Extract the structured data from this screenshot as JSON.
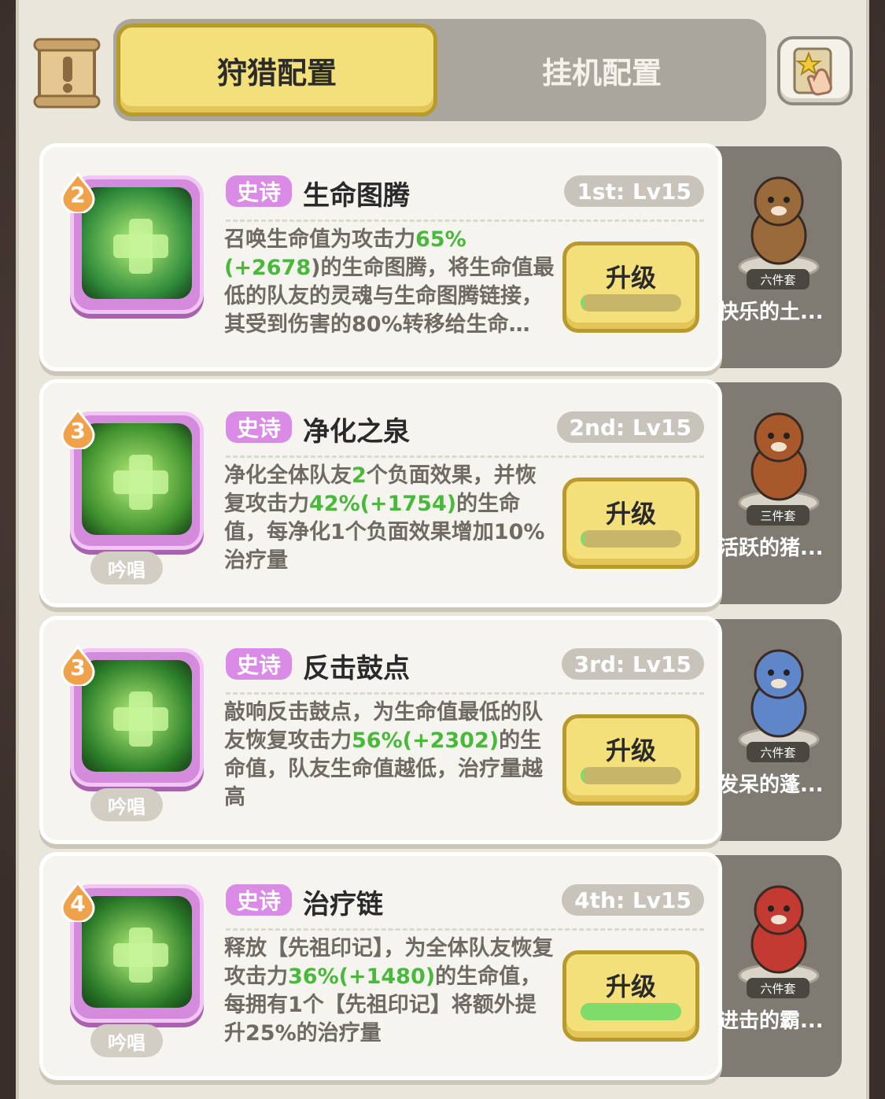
{
  "header": {
    "tab_active": "狩猎配置",
    "tab_inactive": "挂机配置"
  },
  "skills": [
    {
      "rank": "2",
      "rarity": "史诗",
      "name": "生命图腾",
      "level": "1st: Lv15",
      "desc_html": "召唤生命值为攻击力<span class='g'>65%(+2678</span>)的生命图腾，将生命值最低的队友的灵魂与生命图腾链接，其受到伤害的80%转移给生命…",
      "upgrade_label": "升级",
      "progress": 0.03,
      "chant": "",
      "pet_set": "六件套",
      "pet_name": "快乐的土...",
      "icon_color": "#2f8a3a"
    },
    {
      "rank": "3",
      "rarity": "史诗",
      "name": "净化之泉",
      "level": "2nd: Lv15",
      "desc_html": "净化全体队友<span class='g'>2</span>个负面效果，并恢复攻击力<span class='g'>42%(+1754)</span>的生命值，每净化1个负面效果增加10%治疗量",
      "upgrade_label": "升级",
      "progress": 0.03,
      "chant": "吟唱",
      "pet_set": "三件套",
      "pet_name": "活跃的猪...",
      "icon_color": "#3e8f2d"
    },
    {
      "rank": "3",
      "rarity": "史诗",
      "name": "反击鼓点",
      "level": "3rd: Lv15",
      "desc_html": "敲响反击鼓点，为生命值最低的队友恢复攻击力<span class='g'>56%(+2302)</span>的生命值，队友生命值越低，治疗量越高",
      "upgrade_label": "升级",
      "progress": 0.03,
      "chant": "吟唱",
      "pet_set": "六件套",
      "pet_name": "发呆的蓬...",
      "icon_color": "#2d7f2a"
    },
    {
      "rank": "4",
      "rarity": "史诗",
      "name": "治疗链",
      "level": "4th: Lv15",
      "desc_html": "释放【先祖印记】，为全体队友恢复攻击力<span class='g'>36%(+1480)</span>的生命值，每拥有1个【先祖印记】将额外提升25%的治疗量",
      "upgrade_label": "升级",
      "progress": 1.0,
      "chant": "吟唱",
      "pet_set": "六件套",
      "pet_name": "进击的霸...",
      "icon_color": "#2a7a28"
    }
  ]
}
